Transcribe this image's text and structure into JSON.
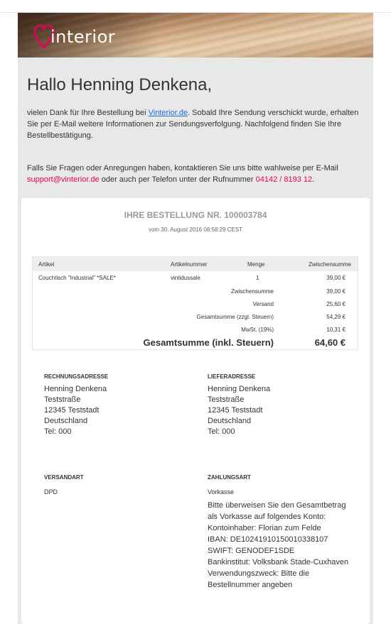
{
  "brand": {
    "logo_text": "interior",
    "accent": "#e6005c"
  },
  "greeting": "Hallo Henning Denkena,",
  "intro": {
    "part1": "vielen Dank für Ihre Bestellung bei ",
    "shop_link": "Vinterior.de",
    "part2": ". Sobald Ihre Sendung verschickt wurde, erhalten Sie per E-Mail weitere Informationen zur Sendungsverfolgung. Nachfolgend finden Sie Ihre Bestellbestätigung."
  },
  "contact": {
    "part1": "Falls Sie Fragen oder Anregungen haben, kontaktieren Sie uns bitte wahlweise per E-Mail ",
    "email": "support@vinterior.de",
    "part2": " oder auch per Telefon unter der Rufnummer ",
    "phone": "04142 / 8193 12",
    "part3": "."
  },
  "order": {
    "title": "IHRE BESTELLUNG NR. 100003784",
    "date": "vom 30. August 2016 08:58:29 CEST",
    "columns": {
      "article": "Artikel",
      "sku": "Artikelnummer",
      "qty": "Menge",
      "subtotal": "Zwischensumme"
    },
    "items": [
      {
        "name": "Couchtisch \"Industrial\" *SALE*",
        "sku": "vintidussale",
        "qty": "1",
        "subtotal": "39,00 €"
      }
    ],
    "totals": {
      "subtotal_label": "Zwischensumme",
      "subtotal": "39,00 €",
      "shipping_label": "Versand",
      "shipping": "25,60 €",
      "net_label": "Gesamtsumme (zzgl. Steuern)",
      "net": "54,29 €",
      "tax_label": "MwSt. (19%)",
      "tax": "10,31 €",
      "grand_label": "Gesamtsumme (inkl. Steuern)",
      "grand": "64,60 €"
    }
  },
  "billing": {
    "heading": "RECHNUNGSADRESSE",
    "name": "Henning Denkena",
    "street": "Teststraße",
    "city": "12345 Teststadt",
    "country": "Deutschland",
    "tel": "Tel: 000"
  },
  "shipping_address": {
    "heading": "LIEFERADRESSE",
    "name": "Henning Denkena",
    "street": "Teststraße",
    "city": "12345 Teststadt",
    "country": "Deutschland",
    "tel": "Tel: 000"
  },
  "shipping_method": {
    "heading": "VERSANDART",
    "value": "DPD"
  },
  "payment": {
    "heading": "ZAHLUNGSART",
    "method": "Vorkasse",
    "instructions": "Bitte überweisen Sie den Gesamtbetrag als Vorkasse auf folgendes Konto:",
    "holder": "Kontoinhaber: Florian zum Felde",
    "iban": "IBAN: DE10241910150010338107",
    "swift": "SWIFT: GENODEF1SDE",
    "bank": "Bankinstitut: Volksbank Stade-Cuxhaven",
    "reference": "Verwendungszweck: Bitte die Bestellnummer angeben"
  }
}
